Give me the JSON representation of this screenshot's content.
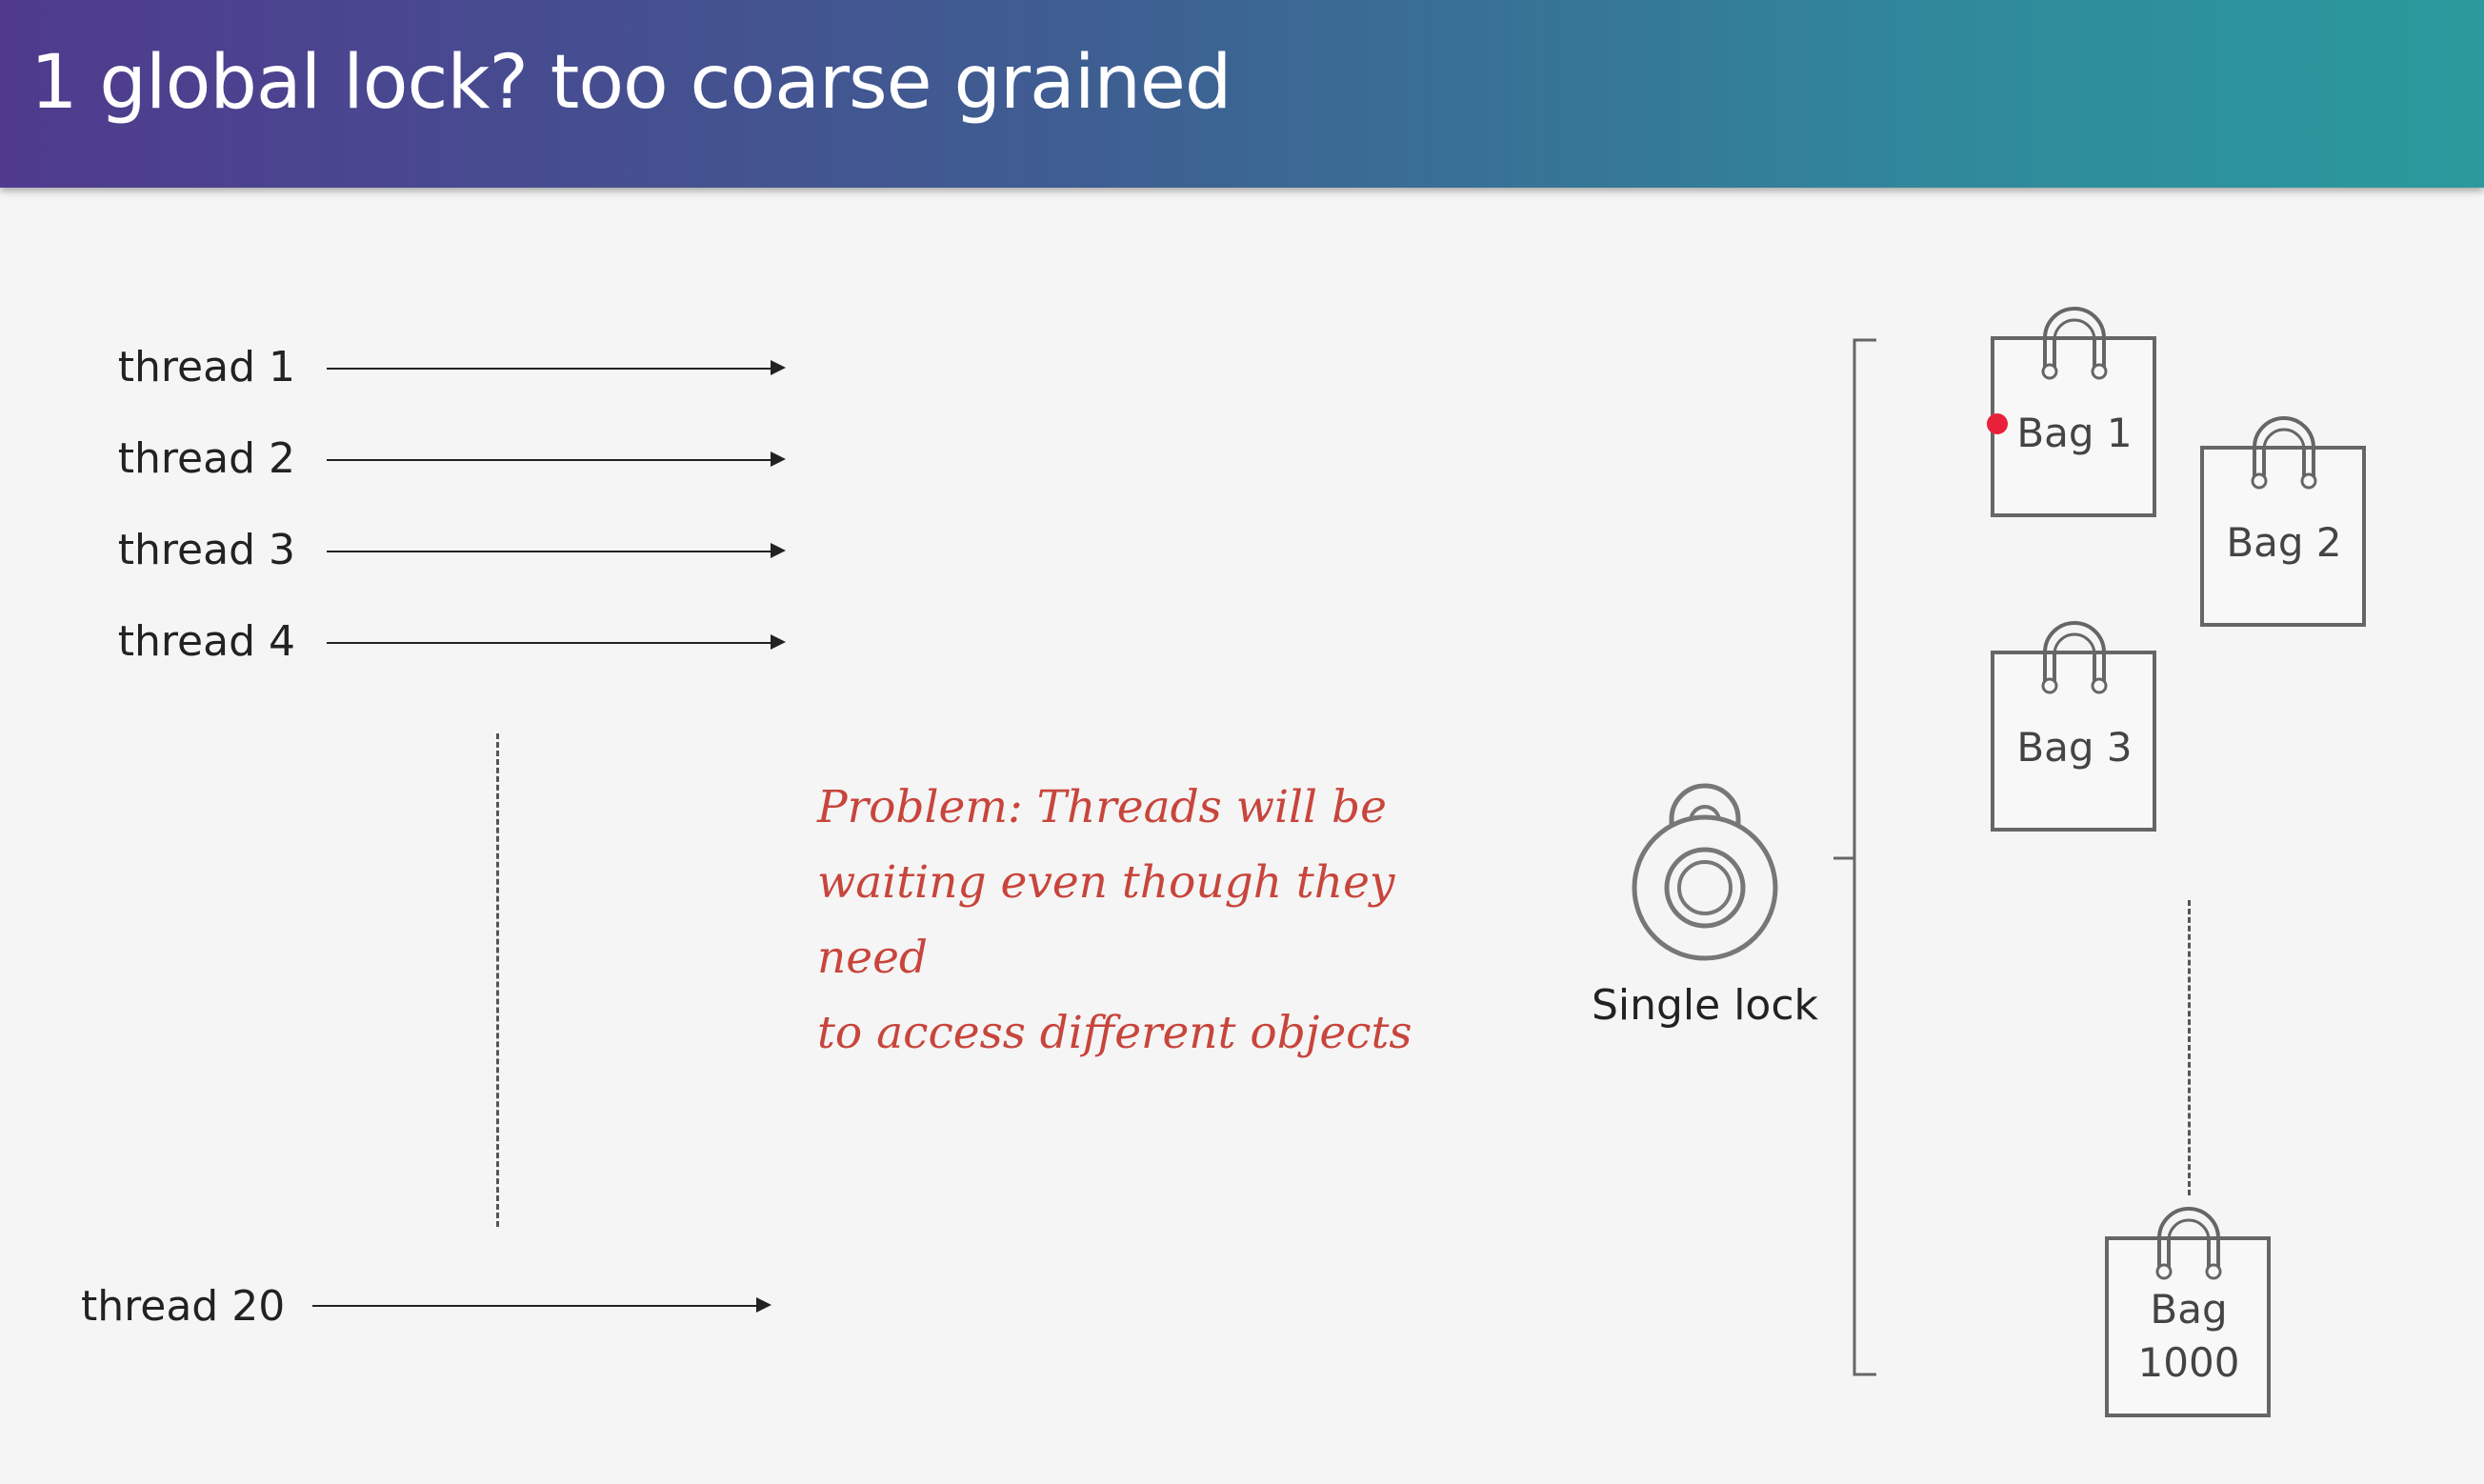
{
  "header": {
    "title": "1 global lock? too coarse grained"
  },
  "threads": [
    {
      "label": "thread 1"
    },
    {
      "label": "thread 2"
    },
    {
      "label": "thread 3"
    },
    {
      "label": "thread 4"
    },
    {
      "label": "thread 20"
    }
  ],
  "problem_note": {
    "line1": "Problem: Threads will be",
    "line2": "waiting even though they need",
    "line3": "to access different objects"
  },
  "lock": {
    "label": "Single lock",
    "icon": "padlock-icon"
  },
  "bags": [
    {
      "label": "Bag 1",
      "icon": "shopping-bag-icon"
    },
    {
      "label": "Bag 2",
      "icon": "shopping-bag-icon"
    },
    {
      "label": "Bag 3",
      "icon": "shopping-bag-icon"
    },
    {
      "label_line1": "Bag",
      "label_line2": "1000",
      "icon": "shopping-bag-icon"
    }
  ],
  "colors": {
    "header_start": "#4f3a8e",
    "header_end": "#2a9a9c",
    "note": "#c8453c",
    "pointer_dot": "#e8203a"
  }
}
